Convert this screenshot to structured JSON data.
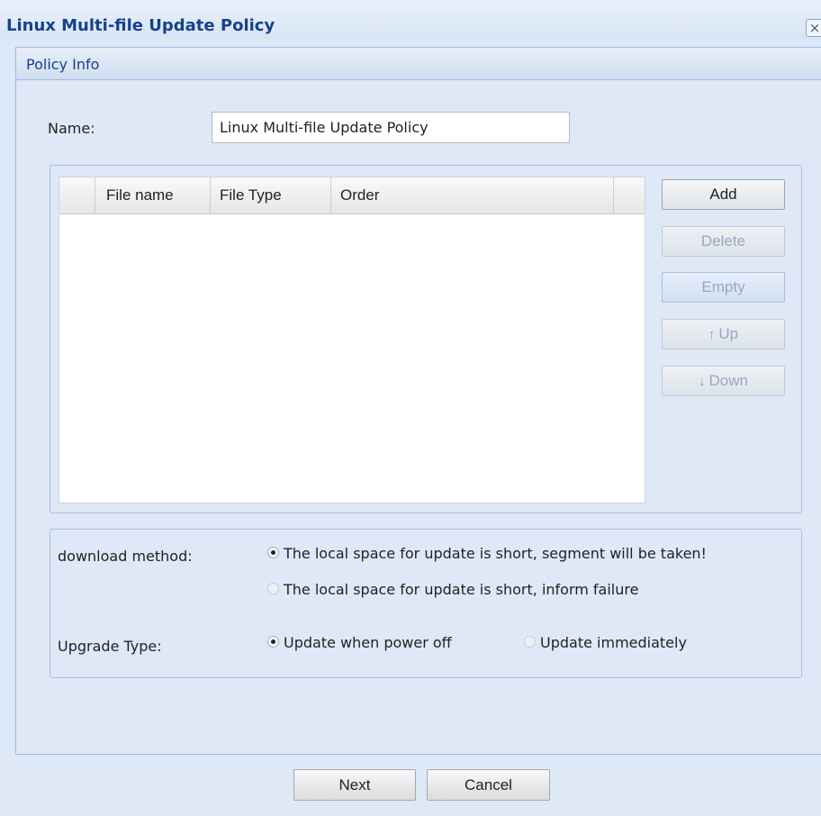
{
  "window": {
    "title": "Linux Multi-file Update Policy",
    "close_glyph": "×"
  },
  "panel": {
    "title": "Policy Info"
  },
  "form": {
    "name_label": "Name:",
    "name_value": "Linux Multi-file Update Policy"
  },
  "grid": {
    "columns": [
      "",
      "File name",
      "File Type",
      "Order",
      ""
    ],
    "rows": []
  },
  "actions": {
    "add": "Add",
    "delete": "Delete",
    "empty": "Empty",
    "up": "Up",
    "down": "Down",
    "up_icon": "↑",
    "down_icon": "↓"
  },
  "download_method": {
    "label": "download method:",
    "options": [
      {
        "text": "The local space for update is short, segment will be taken!",
        "checked": true
      },
      {
        "text": "The local space for update is short, inform failure",
        "checked": false
      }
    ]
  },
  "upgrade_type": {
    "label": "Upgrade Type:",
    "options": [
      {
        "text": "Update when power off",
        "checked": true
      },
      {
        "text": "Update immediately",
        "checked": false
      }
    ]
  },
  "footer": {
    "next": "Next",
    "cancel": "Cancel"
  },
  "colors": {
    "background": "#dfe8f6",
    "title_text": "#15428b",
    "border": "#99bbe8"
  }
}
